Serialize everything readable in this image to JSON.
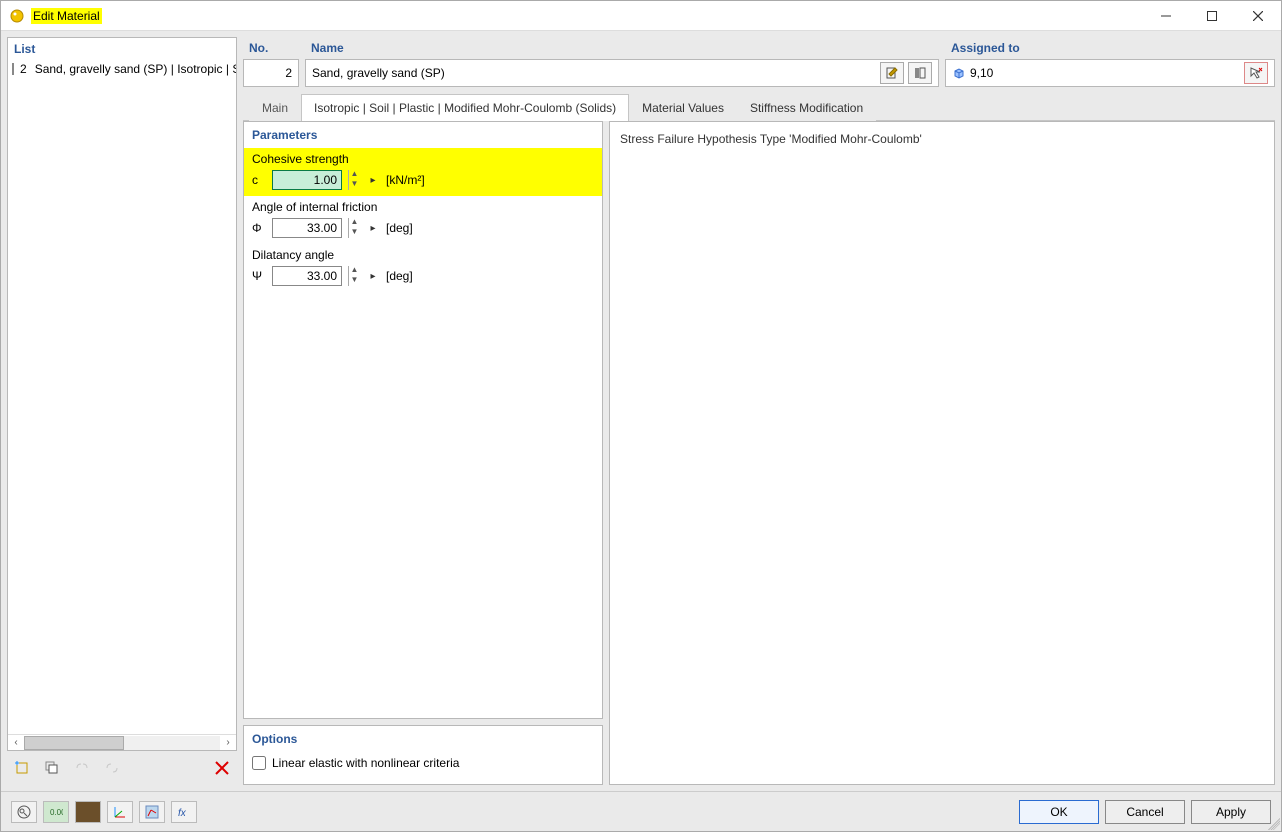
{
  "window": {
    "title": "Edit Material"
  },
  "sidebar": {
    "header": "List",
    "items": [
      {
        "num": "2",
        "text": "Sand, gravelly sand (SP) | Isotropic | S"
      }
    ],
    "toolbar": {
      "new": "New",
      "copy": "Copy",
      "link": "Link",
      "unlink": "Unlink",
      "delete": "Delete"
    }
  },
  "header": {
    "no_label": "No.",
    "no_value": "2",
    "name_label": "Name",
    "name_value": "Sand, gravelly sand (SP)",
    "edit_tip": "Edit",
    "library_tip": "Library",
    "assigned_label": "Assigned to",
    "assigned_value": "9,10",
    "pick_tip": "Pick"
  },
  "tabs": [
    {
      "id": "main",
      "label": "Main"
    },
    {
      "id": "model",
      "label": "Isotropic | Soil | Plastic | Modified Mohr-Coulomb (Solids)",
      "active": true
    },
    {
      "id": "values",
      "label": "Material Values"
    },
    {
      "id": "stiff",
      "label": "Stiffness Modification"
    }
  ],
  "params": {
    "title": "Parameters",
    "cohesive": {
      "label": "Cohesive strength",
      "symbol": "c",
      "value": "1.00",
      "unit_html": "[kN/m²]"
    },
    "friction": {
      "label": "Angle of internal friction",
      "symbol": "Φ",
      "value": "33.00",
      "unit": "[deg]"
    },
    "dilatancy": {
      "label": "Dilatancy angle",
      "symbol": "Ψ",
      "value": "33.00",
      "unit": "[deg]"
    }
  },
  "options": {
    "title": "Options",
    "linear_elastic": "Linear elastic with nonlinear criteria"
  },
  "right": {
    "hypothesis": "Stress Failure Hypothesis Type 'Modified Mohr-Coulomb'"
  },
  "footer": {
    "ok": "OK",
    "cancel": "Cancel",
    "apply": "Apply"
  }
}
